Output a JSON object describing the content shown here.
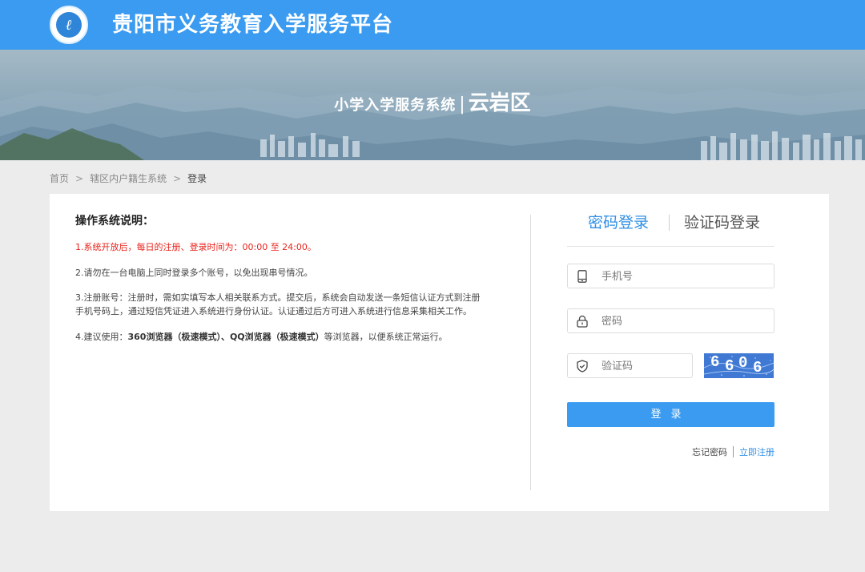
{
  "header": {
    "site_title": "贵阳市义务教育入学服务平台",
    "logo_icon": "school-emblem-icon"
  },
  "banner": {
    "system_name": "小学入学服务系统",
    "separator": "|",
    "district": "云岩区"
  },
  "breadcrumb": {
    "items": [
      "首页",
      "辖区内户籍生系统",
      "登录"
    ],
    "separator": ">"
  },
  "instructions": {
    "title": "操作系统说明：",
    "item1": "1.系统开放后，每日的注册、登录时间为：00:00 至 24:00。",
    "item2": "2.请勿在一台电脑上同时登录多个账号，以免出现串号情况。",
    "item3_line1": "3.注册账号：注册时，需如实填写本人相关联系方式。提交后，系统会自动发送一条短信认证方式到注册",
    "item3_line2": "手机号码上，通过短信凭证进入系统进行身份认证。认证通过后方可进入系统进行信息采集相关工作。",
    "item4_prefix": "4.建议使用：",
    "item4_bold": "360浏览器（极速模式）、QQ浏览器（极速模式）",
    "item4_suffix": "等浏览器，以便系统正常运行。"
  },
  "login": {
    "tab_password": "密码登录",
    "tab_code": "验证码登录",
    "active_tab": "密码登录",
    "phone_placeholder": "手机号",
    "password_placeholder": "密码",
    "captcha_placeholder": "验证码",
    "captcha_text": "6606",
    "login_button": "登录",
    "forgot_password": "忘记密码",
    "register": "立即注册"
  },
  "colors": {
    "primary": "#3a9bf0",
    "notice_red": "#e8231b",
    "captcha_bg": "#3f79d4",
    "page_bg": "#ececec"
  },
  "icons": {
    "phone": "mobile-phone-icon",
    "password": "lock-icon",
    "captcha": "shield-icon"
  }
}
